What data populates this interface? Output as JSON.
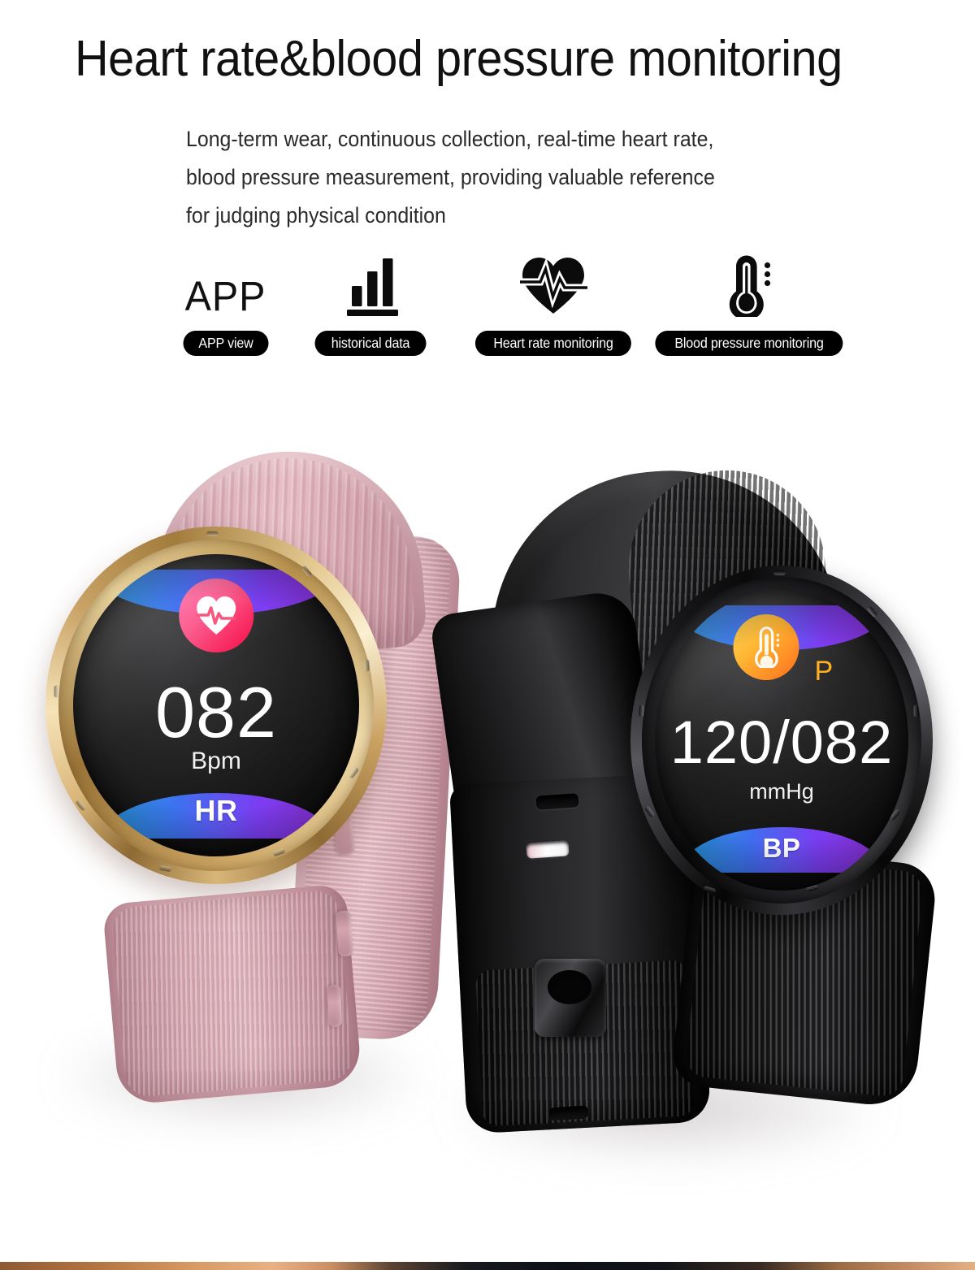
{
  "header": {
    "title": "Heart rate&blood pressure monitoring",
    "description_lines": [
      "Long-term wear, continuous collection, real-time heart rate,",
      "blood pressure measurement, providing valuable reference",
      "for judging physical condition"
    ]
  },
  "features": [
    {
      "icon": "app-text-icon",
      "icon_text": "APP",
      "label": "APP view"
    },
    {
      "icon": "bar-chart-icon",
      "icon_text": "",
      "label": "historical data"
    },
    {
      "icon": "heart-pulse-icon",
      "icon_text": "",
      "label": "Heart rate monitoring"
    },
    {
      "icon": "thermometer-icon",
      "icon_text": "",
      "label": "Blood pressure monitoring"
    }
  ],
  "products": {
    "pink_gold_watch": {
      "case_color": "#d9b679",
      "strap_color": "#d4a0ab",
      "face": {
        "badge_icon": "heart-pulse-badge-icon",
        "badge_color": "#f8285f",
        "value": "082",
        "unit": "Bpm",
        "mode_label": "HR",
        "wing_color_start": "#2aa7f0",
        "wing_color_end": "#9b35ef"
      }
    },
    "black_watch": {
      "case_color": "#1d1d1f",
      "strap_color": "#0a0a0a",
      "face": {
        "badge_icon": "thermometer-badge-icon",
        "badge_color": "#ff8a24",
        "badge_suffix": "P",
        "value": "120/082",
        "unit": "mmHg",
        "mode_label": "BP",
        "wing_color_start": "#2aa7f0",
        "wing_color_end": "#9b35ef"
      }
    }
  },
  "theme": {
    "background": "#ffffff",
    "text_color": "#111111",
    "pill_background": "#000000",
    "pill_text": "#ffffff"
  }
}
